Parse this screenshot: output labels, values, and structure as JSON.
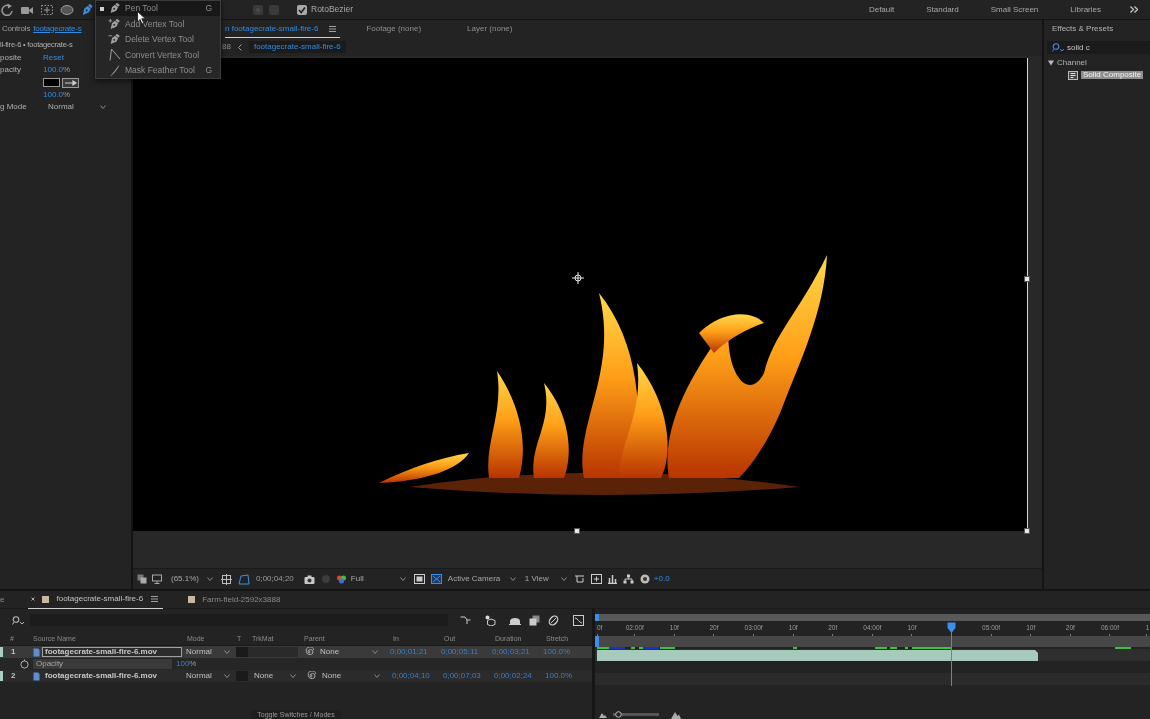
{
  "toolbar": {
    "tools": [
      {
        "kind": "rotate",
        "selected": false
      },
      {
        "kind": "camera",
        "selected": false
      },
      {
        "kind": "pan",
        "selected": false
      },
      {
        "kind": "ellipse",
        "selected": false
      },
      {
        "kind": "pen",
        "selected": true
      }
    ],
    "rotobezier": {
      "label": "RotoBezier",
      "checked": true
    },
    "workspaces": [
      "Default",
      "Standard",
      "Small Screen",
      "Libraries"
    ]
  },
  "tool_menu": {
    "items": [
      {
        "kind": "pen",
        "label": "Pen Tool",
        "shortcut": "G",
        "selected": true
      },
      {
        "kind": "add",
        "label": "Add Vertex Tool",
        "selected": false
      },
      {
        "kind": "delete",
        "label": "Delete Vertex Tool",
        "selected": false
      },
      {
        "kind": "convert",
        "label": "Convert Vertex Tool",
        "selected": false
      },
      {
        "kind": "feather",
        "label": "Mask Feather Tool",
        "shortcut": "G",
        "selected": false
      }
    ]
  },
  "effect_controls": {
    "title": "Controls",
    "layer_link": "footagecrate-s",
    "breadcrumb": "ll-fire-6 • footagecrate-s",
    "properties": [
      {
        "kind": "link",
        "name": "posite",
        "value": "Reset"
      },
      {
        "kind": "number",
        "name": "pacity",
        "value": "100.0",
        "unit": "%"
      },
      {
        "kind": "swatch"
      },
      {
        "kind": "number",
        "value": "100.0",
        "unit": "%"
      },
      {
        "kind": "dropdown",
        "name": "g Mode",
        "value": "Normal"
      }
    ]
  },
  "composition": {
    "tabs": [
      {
        "label": "n footagecrate-small-fire-6",
        "selected": true
      },
      {
        "label": "Footage (none)",
        "selected": false
      },
      {
        "label": "Layer (none)",
        "selected": false
      }
    ],
    "breadcrumb": [
      {
        "label": "88",
        "selected": false
      },
      {
        "label": "footagecrate-small-fire-6",
        "selected": true
      }
    ]
  },
  "viewer_bar": {
    "magnification": "(65.1%)",
    "timecode": "0;00;04;20",
    "resolution": "Full",
    "camera": "Active Camera",
    "views": "1 View",
    "exposure": "+0.0"
  },
  "effects_presets": {
    "title": "Effects & Presets",
    "search": "solid c",
    "tree": [
      {
        "label": "Channel",
        "expanded": true,
        "children": [
          {
            "label": "Solid Composite",
            "selected": true
          }
        ]
      }
    ]
  },
  "timeline": {
    "cut_tab": "e",
    "tabs": [
      {
        "label": "footagecrate-small-fire-6",
        "selected": true
      },
      {
        "label": "Farm-field-2592x3888",
        "selected": false
      }
    ],
    "columns": [
      "#",
      "Source Name",
      "Mode",
      "T",
      "TrkMat",
      "Parent",
      "In",
      "Out",
      "Duration",
      "Stretch"
    ],
    "layers": [
      {
        "number": "1",
        "name": "footagecrate-small-fire-6.mov",
        "selected": true,
        "mode": "Normal",
        "parent": "None",
        "in": "0;00;01;21",
        "out": "0;00;05;11",
        "duration": "0;00;03;21",
        "stretch": "100.0%",
        "bar_visible": true,
        "properties": [
          {
            "name": "Opacity",
            "value": "100",
            "unit": "%"
          }
        ]
      },
      {
        "number": "2",
        "name": "footagecrate-small-fire-6.mov",
        "selected": false,
        "mode": "Normal",
        "trkmat": "None",
        "parent": "None",
        "in": "0;00;04;10",
        "out": "0;00;07;03",
        "duration": "0;00;02;24",
        "stretch": "100.0%",
        "bar_visible": false
      }
    ],
    "ruler": [
      {
        "kind": "label",
        "text": "0f"
      },
      {
        "kind": "label",
        "text": "02:00f"
      },
      {
        "kind": "label",
        "text": "10f"
      },
      {
        "kind": "label",
        "text": "20f"
      },
      {
        "kind": "label",
        "text": "03:00f"
      },
      {
        "kind": "label",
        "text": "10f"
      },
      {
        "kind": "label",
        "text": "20f"
      },
      {
        "kind": "label",
        "text": "04:00f"
      },
      {
        "kind": "label",
        "text": "10f"
      },
      {
        "kind": "playhead"
      },
      {
        "kind": "label",
        "text": "05:00f"
      },
      {
        "kind": "label",
        "text": "10f"
      },
      {
        "kind": "label",
        "text": "20f"
      },
      {
        "kind": "label",
        "text": "06:00f"
      },
      {
        "kind": "label",
        "text": "1"
      }
    ],
    "zoom_slider": {
      "level": 0.05
    },
    "footer": "Toggle Switches / Modes"
  }
}
